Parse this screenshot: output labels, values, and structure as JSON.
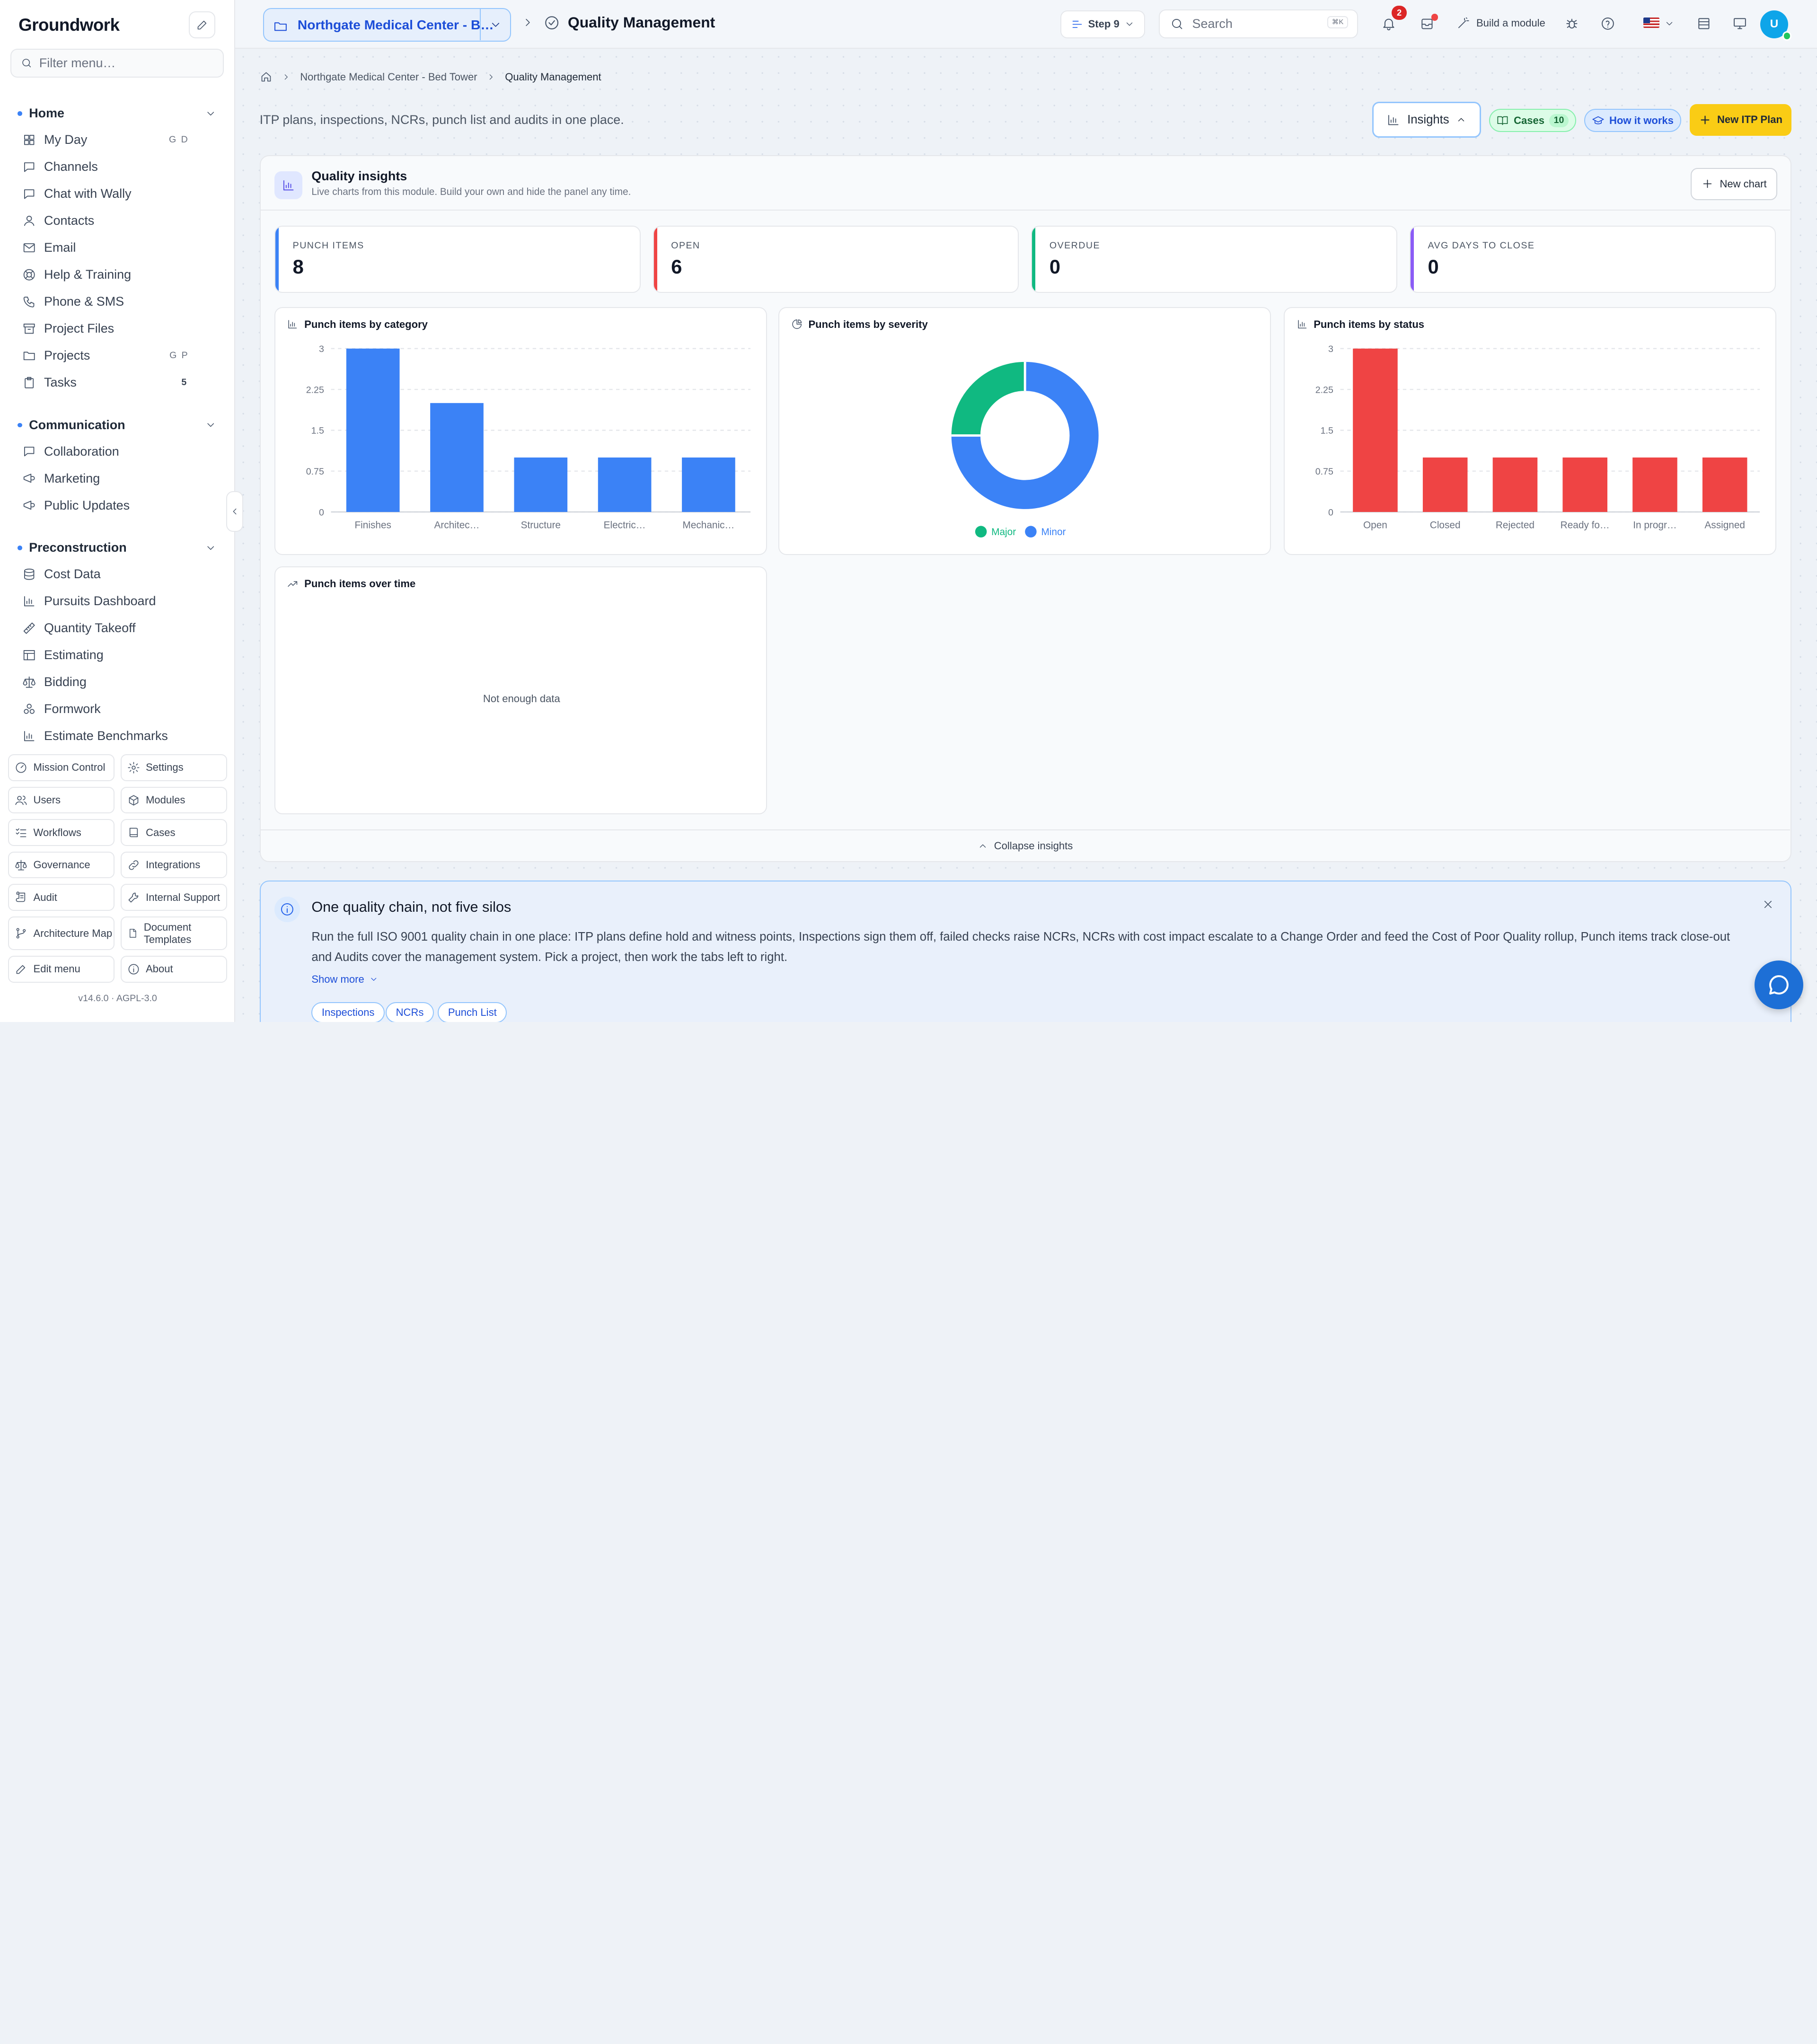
{
  "brand": "Groundwork",
  "sidebar": {
    "filter_placeholder": "Filter menu…",
    "sections": [
      {
        "title": "Home",
        "items": [
          {
            "label": "My Day",
            "icon": "grid-icon",
            "kbd": "G D"
          },
          {
            "label": "Channels",
            "icon": "chat-bubble-icon"
          },
          {
            "label": "Chat with Wally",
            "icon": "chat-bubble-icon"
          },
          {
            "label": "Contacts",
            "icon": "user-icon"
          },
          {
            "label": "Email",
            "icon": "mail-icon"
          },
          {
            "label": "Help & Training",
            "icon": "lifebuoy-icon"
          },
          {
            "label": "Phone & SMS",
            "icon": "phone-icon"
          },
          {
            "label": "Project Files",
            "icon": "archive-icon"
          },
          {
            "label": "Projects",
            "icon": "folder-icon",
            "kbd": "G P"
          },
          {
            "label": "Tasks",
            "icon": "clipboard-icon",
            "count": "5"
          }
        ]
      },
      {
        "title": "Communication",
        "items": [
          {
            "label": "Collaboration",
            "icon": "chat-bubble-icon"
          },
          {
            "label": "Marketing",
            "icon": "megaphone-icon"
          },
          {
            "label": "Public Updates",
            "icon": "megaphone-icon"
          }
        ]
      },
      {
        "title": "Preconstruction",
        "items": [
          {
            "label": "Cost Data",
            "icon": "database-icon"
          },
          {
            "label": "Pursuits Dashboard",
            "icon": "bar-chart-icon"
          },
          {
            "label": "Quantity Takeoff",
            "icon": "ruler-icon"
          },
          {
            "label": "Estimating",
            "icon": "table-icon"
          },
          {
            "label": "Bidding",
            "icon": "scale-icon"
          },
          {
            "label": "Formwork",
            "icon": "blocks-icon"
          },
          {
            "label": "Estimate Benchmarks",
            "icon": "bar-chart-icon"
          }
        ]
      }
    ],
    "bottom_buttons": [
      {
        "label": "Mission Control",
        "icon": "gauge-icon"
      },
      {
        "label": "Settings",
        "icon": "gear-icon"
      },
      {
        "label": "Users",
        "icon": "users-icon"
      },
      {
        "label": "Modules",
        "icon": "package-icon"
      },
      {
        "label": "Workflows",
        "icon": "list-checks-icon"
      },
      {
        "label": "Cases",
        "icon": "book-icon"
      },
      {
        "label": "Governance",
        "icon": "scale-icon"
      },
      {
        "label": "Integrations",
        "icon": "link-icon"
      },
      {
        "label": "Audit",
        "icon": "scroll-icon"
      },
      {
        "label": "Internal Support",
        "icon": "wrench-icon"
      },
      {
        "label": "Architecture Map",
        "icon": "git-branch-icon"
      },
      {
        "label": "Document Templates",
        "icon": "file-icon"
      },
      {
        "label": "Edit menu",
        "icon": "pencil-icon"
      },
      {
        "label": "About",
        "icon": "info-icon"
      }
    ],
    "version": "v14.6.0  ·  AGPL-3.0"
  },
  "topbar": {
    "project": "Northgate Medical Center - B…",
    "module_title": "Quality Management",
    "step": "Step 9",
    "search_placeholder": "Search",
    "search_kbd": "⌘K",
    "notifications_count": "2",
    "build_module": "Build a module",
    "avatar": "U"
  },
  "breadcrumb": {
    "project": "Northgate Medical Center - Bed Tower",
    "current": "Quality Management"
  },
  "page": {
    "subtitle": "ITP plans, inspections, NCRs, punch list and audits in one place.",
    "insights_btn": "Insights",
    "cases_btn": "Cases",
    "cases_count": "10",
    "how_btn": "How it works",
    "new_itp_btn": "New ITP Plan"
  },
  "insights": {
    "title": "Quality insights",
    "subtitle": "Live charts from this module. Build your own and hide the panel any time.",
    "new_chart": "New chart",
    "collapse": "Collapse insights",
    "kpis": [
      {
        "label": "PUNCH ITEMS",
        "value": "8",
        "color": "#3b82f6"
      },
      {
        "label": "OPEN",
        "value": "6",
        "color": "#ef4444"
      },
      {
        "label": "OVERDUE",
        "value": "0",
        "color": "#10b981"
      },
      {
        "label": "AVG DAYS TO CLOSE",
        "value": "0",
        "color": "#8b5cf6"
      }
    ]
  },
  "chart_data": [
    {
      "type": "bar",
      "title": "Punch items by category",
      "categories": [
        "Finishes",
        "Architec…",
        "Structure",
        "Electric…",
        "Mechanic…"
      ],
      "values": [
        3,
        2,
        1,
        1,
        1
      ],
      "ylim": [
        0,
        3
      ],
      "yticks": [
        "0",
        "0.75",
        "1.5",
        "2.25",
        "3"
      ],
      "color": "#3b82f6",
      "grid": true
    },
    {
      "type": "pie",
      "title": "Punch items by severity",
      "labels": [
        "Major",
        "Minor"
      ],
      "values": [
        2,
        6
      ],
      "colors": [
        "#10b981",
        "#3b82f6"
      ],
      "legend": "bottom"
    },
    {
      "type": "bar",
      "title": "Punch items by status",
      "categories": [
        "Open",
        "Closed",
        "Rejected",
        "Ready fo…",
        "In progr…",
        "Assigned"
      ],
      "values": [
        3,
        1,
        1,
        1,
        1,
        1
      ],
      "ylim": [
        0,
        3
      ],
      "yticks": [
        "0",
        "0.75",
        "1.5",
        "2.25",
        "3"
      ],
      "color": "#ef4444",
      "grid": true
    },
    {
      "type": "line",
      "title": "Punch items over time",
      "empty_text": "Not enough data"
    }
  ],
  "info": {
    "title": "One quality chain, not five silos",
    "body": "Run the full ISO 9001 quality chain in one place: ITP plans define hold and witness points, Inspections sign them off, failed checks raise NCRs, NCRs with cost impact escalate to a Change Order and feed the Cost of Poor Quality rollup, Punch items track close-out and Audits cover the management system. Pick a project, then work the tabs left to right.",
    "show_more": "Show more",
    "chips": [
      "Inspections",
      "NCRs",
      "Punch List"
    ]
  }
}
